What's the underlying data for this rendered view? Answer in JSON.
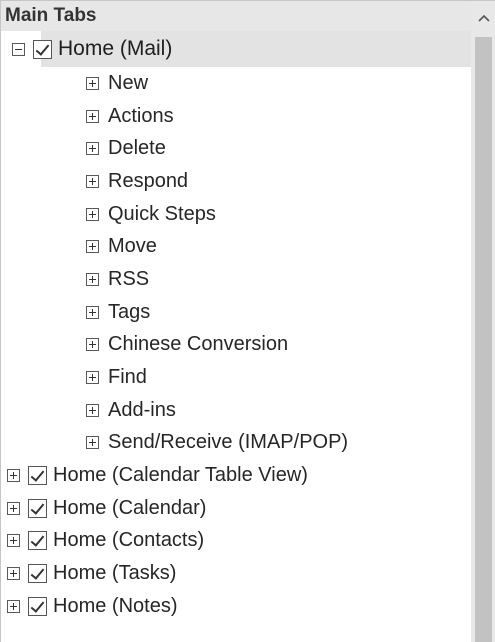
{
  "header": {
    "title": "Main Tabs"
  },
  "tree": {
    "selected": {
      "label": "Home (Mail)",
      "expanded": true,
      "checked": true,
      "children": [
        "New",
        "Actions",
        "Delete",
        "Respond",
        "Quick Steps",
        "Move",
        "RSS",
        "Tags",
        "Chinese Conversion",
        "Find",
        "Add-ins",
        "Send/Receive (IMAP/POP)"
      ]
    },
    "others": [
      {
        "label": "Home (Calendar Table View)",
        "checked": true,
        "expanded": false
      },
      {
        "label": "Home (Calendar)",
        "checked": true,
        "expanded": false
      },
      {
        "label": "Home (Contacts)",
        "checked": true,
        "expanded": false
      },
      {
        "label": "Home (Tasks)",
        "checked": true,
        "expanded": false
      },
      {
        "label": "Home (Notes)",
        "checked": true,
        "expanded": false
      }
    ]
  },
  "scrollbar": {
    "up_arrow_icon": "chevron-up-icon"
  }
}
